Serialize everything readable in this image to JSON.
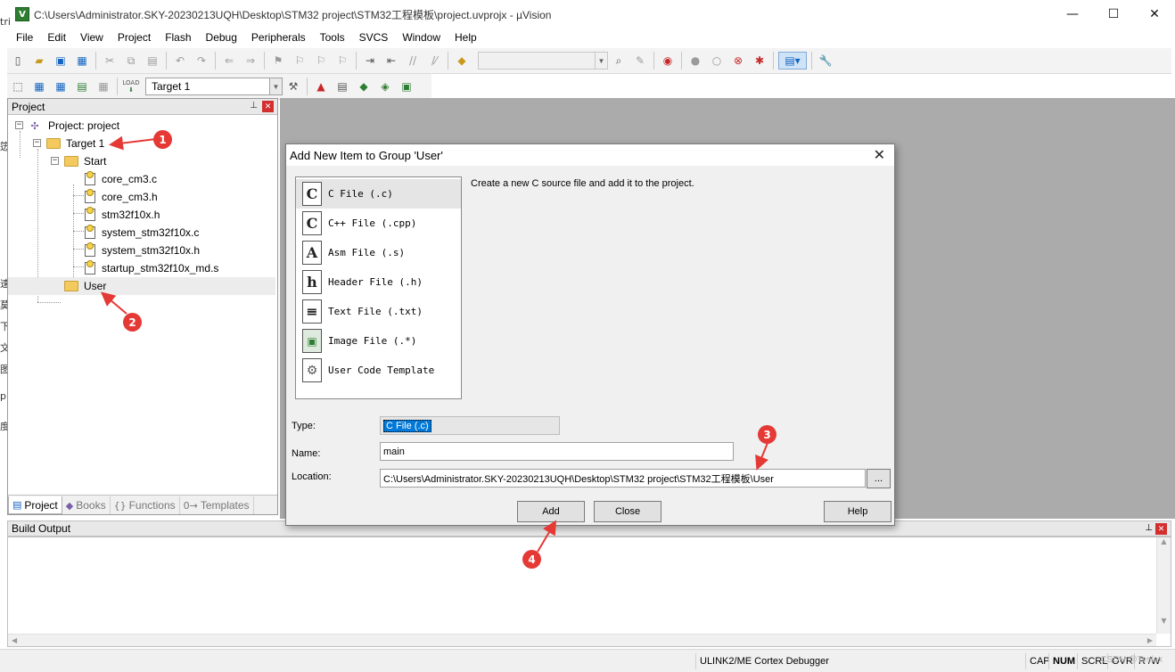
{
  "window": {
    "title": "C:\\Users\\Administrator.SKY-20230213UQH\\Desktop\\STM32 project\\STM32工程模板\\project.uvprojx - µVision",
    "app_icon_letter": "V",
    "minimize": "—",
    "maximize": "☐",
    "close": "✕"
  },
  "menu": [
    "File",
    "Edit",
    "View",
    "Project",
    "Flash",
    "Debug",
    "Peripherals",
    "Tools",
    "SVCS",
    "Window",
    "Help"
  ],
  "toolbar2": {
    "target": "Target 1",
    "load_label": "LOAD"
  },
  "project_panel": {
    "title": "Project",
    "pin": "📌",
    "close": "✕",
    "root": "Project: project",
    "target": "Target 1",
    "groups": [
      {
        "name": "Start",
        "files": [
          "core_cm3.c",
          "core_cm3.h",
          "stm32f10x.h",
          "system_stm32f10x.c",
          "system_stm32f10x.h",
          "startup_stm32f10x_md.s"
        ]
      },
      {
        "name": "User",
        "files": []
      }
    ],
    "tabs": [
      {
        "icon": "▤",
        "label": "Project"
      },
      {
        "icon": "◆",
        "label": "Books"
      },
      {
        "icon": "{}",
        "label": "Functions"
      },
      {
        "icon": "0→",
        "label": "Templates"
      }
    ]
  },
  "dialog": {
    "title": "Add New Item to Group 'User'",
    "close": "✕",
    "types": [
      {
        "icon": "C",
        "label": "C File (.c)"
      },
      {
        "icon": "C",
        "label": "C++ File (.cpp)"
      },
      {
        "icon": "A",
        "label": "Asm File (.s)"
      },
      {
        "icon": "h",
        "label": "Header File (.h)"
      },
      {
        "icon": "≡",
        "label": "Text File (.txt)"
      },
      {
        "icon": "▣",
        "label": "Image File (.*)"
      },
      {
        "icon": "⚙",
        "label": "User Code Template"
      }
    ],
    "description": "Create a new C source file and add it to the project.",
    "type_label": "Type:",
    "type_value": "C File (.c)",
    "name_label": "Name:",
    "name_value": "main",
    "location_label": "Location:",
    "location_value": "C:\\Users\\Administrator.SKY-20230213UQH\\Desktop\\STM32 project\\STM32工程模板\\User",
    "browse": "...",
    "add": "Add",
    "close_btn": "Close",
    "help": "Help"
  },
  "build_output": {
    "title": "Build Output",
    "pin": "📌",
    "close": "✕"
  },
  "status_bar": {
    "debugger": "ULINK2/ME Cortex Debugger",
    "cap": "CAP",
    "num": "NUM",
    "scrl": "SCRL",
    "ovr": "OVR",
    "rw": "R /W",
    "watermark": "CSDN @Teslax"
  },
  "annotations": [
    "1",
    "2",
    "3",
    "4"
  ],
  "colors": {
    "marker": "#e53935",
    "editor_bg": "#ababab",
    "selection": "#0078d7"
  }
}
